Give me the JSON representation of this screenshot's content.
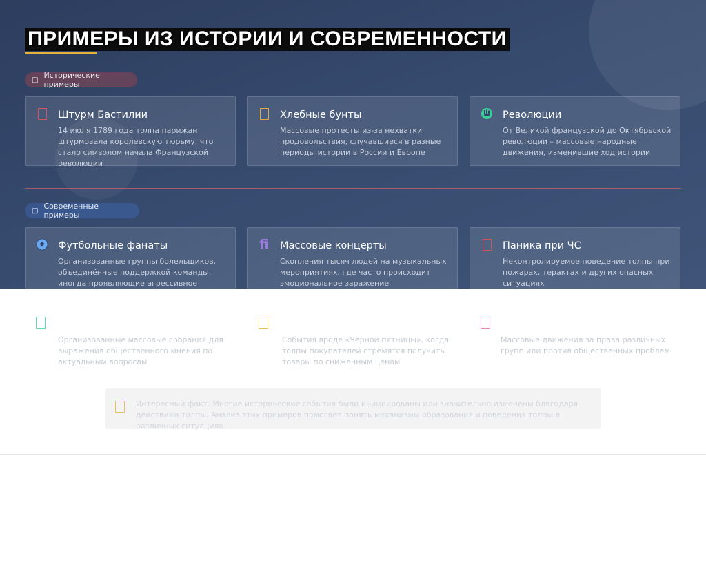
{
  "title": "ПРИМЕРЫ ИЗ ИСТОРИИ И СОВРЕМЕННОСТИ",
  "historical": {
    "badge_label": "Исторические примеры",
    "cards": [
      {
        "title": "Штурм Бастилии",
        "desc": "14 июля 1789 года толпа парижан штурмовала королевскую тюрьму, что стало символом начала Французской революции",
        "icon": "document-icon",
        "icon_color": "#d9505e"
      },
      {
        "title": "Хлебные бунты",
        "desc": "Массовые протесты из-за нехватки продовольствия, случавшиеся в разные периоды истории в России и Европе",
        "icon": "bread-icon",
        "icon_color": "#e0a93a"
      },
      {
        "title": "Революции",
        "desc": "От Великой французской до Октябрьской революции – массовые народные движения, изменившие ход истории",
        "icon": "raised-fist-icon",
        "icon_color": "#3ccf9a"
      }
    ]
  },
  "modern": {
    "badge_label": "Современные примеры",
    "cards": [
      {
        "title": "Футбольные фанаты",
        "desc": "Организованные группы болельщиков, объединённые поддержкой команды, иногда проявляющие агрессивное поведение",
        "icon": "football-icon",
        "icon_color": "#6aa8f0"
      },
      {
        "title": "Массовые концерты",
        "desc": "Скопления тысяч людей на музыкальных мероприятиях, где часто происходит эмоциональное заражение",
        "icon": "music-icon",
        "icon_color": "#9b7de0",
        "icon_glyph": "ﬁ"
      },
      {
        "title": "Паника при ЧС",
        "desc": "Неконтролируемое поведение толпы при пожарах, терактах и других опасных ситуациях",
        "icon": "alert-icon",
        "icon_color": "#d9505e"
      }
    ]
  },
  "faded_cards": [
    {
      "desc": "Организованные массовые собрания для выражения общественного мнения по актуальным вопросам",
      "icon": "rally-icon",
      "icon_color": "#5ed9b0"
    },
    {
      "desc": "События вроде «Чёрной пятницы», когда толпы покупателей стремятся получить товары по сниженным ценам",
      "icon": "shopping-icon",
      "icon_color": "#eabf5a"
    },
    {
      "desc": "Массовые движения за права различных групп или против общественных проблем",
      "icon": "protest-icon",
      "icon_color": "#e98bb5"
    }
  ],
  "fact": {
    "text": "Интересный факт: Многие исторические события были инициированы или значительно изменены благодаря действиям толпы. Анализ этих примеров помогает понять механизмы образования и поведения толпы в различных ситуациях.",
    "icon": "lightbulb-icon"
  },
  "badge_icons": {
    "historical": "□",
    "modern": "□"
  }
}
